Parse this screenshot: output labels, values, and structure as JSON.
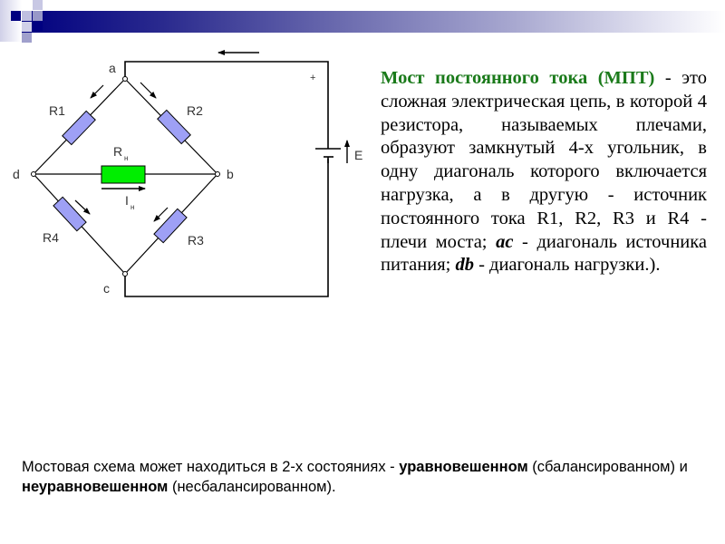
{
  "slide": {
    "description": {
      "title": "Мост постоянного тока (МПТ)",
      "part1": " - это сложная электрическая цепь, в которой 4 резистора, называемых плечами, образуют замкнутый 4-х угольник, в одну диагональ которого включается нагрузка, а в другую - источник постоянного тока  R1, R2, R3 и R4 - плечи моста; ",
      "ac": "ac",
      "part2": " - диагональ источника питания; ",
      "db": "db",
      "part3": " - диагональ нагрузки.)."
    },
    "footer": {
      "text1": "Мостовая схема может находиться в 2-х состояниях - ",
      "bold1": "уравновешенном",
      "text2": " (сбалансированном) и ",
      "bold2": "неуравновешенном",
      "text3": " (несбалансированном)."
    }
  },
  "circuit": {
    "nodes": {
      "a": "a",
      "b": "b",
      "c": "c",
      "d": "d"
    },
    "resistors": {
      "r1": "R1",
      "r2": "R2",
      "r3": "R3",
      "r4": "R4",
      "load_main": "R",
      "load_sub": "н"
    },
    "current": {
      "main": "I",
      "sub": "н"
    },
    "source": {
      "label": "E",
      "polarity": "+"
    },
    "colors": {
      "arm_resistor": "#9ea0f5",
      "load_resistor": "#00ee00",
      "wire": "#000000",
      "title_text": "#1a7a1a",
      "header_dark": "#000080"
    }
  }
}
